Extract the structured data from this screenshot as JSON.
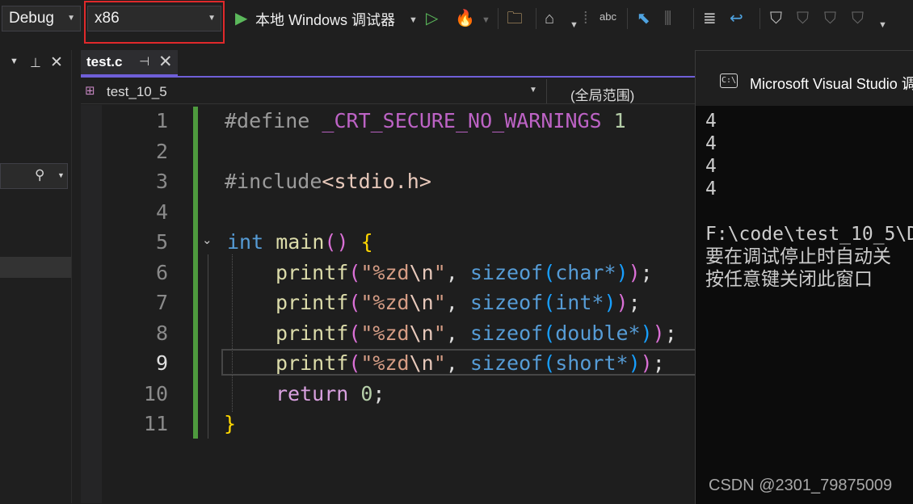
{
  "toolbar": {
    "configuration": "Debug",
    "platform": "x86",
    "run_label": "本地 Windows 调试器",
    "spellcheck_label": "abc"
  },
  "editor_tab": {
    "filename": "test.c",
    "pin_glyph": "⊣",
    "close_glyph": "✕"
  },
  "navigation": {
    "project": "test_10_5",
    "scope": "(全局范围)"
  },
  "line_numbers": [
    "1",
    "2",
    "3",
    "4",
    "5",
    "6",
    "7",
    "8",
    "9",
    "10",
    "11"
  ],
  "current_line": 9,
  "code": {
    "l1": {
      "pp": "#define ",
      "macro": "_CRT_SECURE_NO_WARNINGS",
      "num": " 1"
    },
    "l3": {
      "pp": "#include",
      "inc": "<stdio.h>"
    },
    "l5": {
      "kw": "int",
      "fn": " main",
      "paren": "()",
      "brace": " {"
    },
    "l6": {
      "fn": "printf",
      "str": "\"%zd",
      "esc": "\\n",
      "str2": "\"",
      "kw": "sizeof",
      "type": "char*"
    },
    "l7": {
      "fn": "printf",
      "str": "\"%zd",
      "esc": "\\n",
      "str2": "\"",
      "kw": "sizeof",
      "type": "int*"
    },
    "l8": {
      "fn": "printf",
      "str": "\"%zd",
      "esc": "\\n",
      "str2": "\"",
      "kw": "sizeof",
      "type": "double*"
    },
    "l9": {
      "fn": "printf",
      "str": "\"%zd",
      "esc": "\\n",
      "str2": "\"",
      "kw": "sizeof",
      "type": "short*"
    },
    "l10": {
      "ctl": "return",
      "num": " 0",
      "end": ";"
    },
    "l11": {
      "brace": "}"
    }
  },
  "console": {
    "title": "Microsoft Visual Studio 调",
    "icon_text": "C:\\",
    "output_lines": [
      "4",
      "4",
      "4",
      "4",
      "",
      "F:\\code\\test_10_5\\D",
      "要在调试停止时自动关",
      "按任意键关闭此窗口"
    ]
  },
  "watermark": "CSDN @2301_79875009",
  "colors": {
    "highlight_box": "#e0292b",
    "change_bar": "#4e9a3e",
    "tab_accent": "#6f5fd8"
  }
}
